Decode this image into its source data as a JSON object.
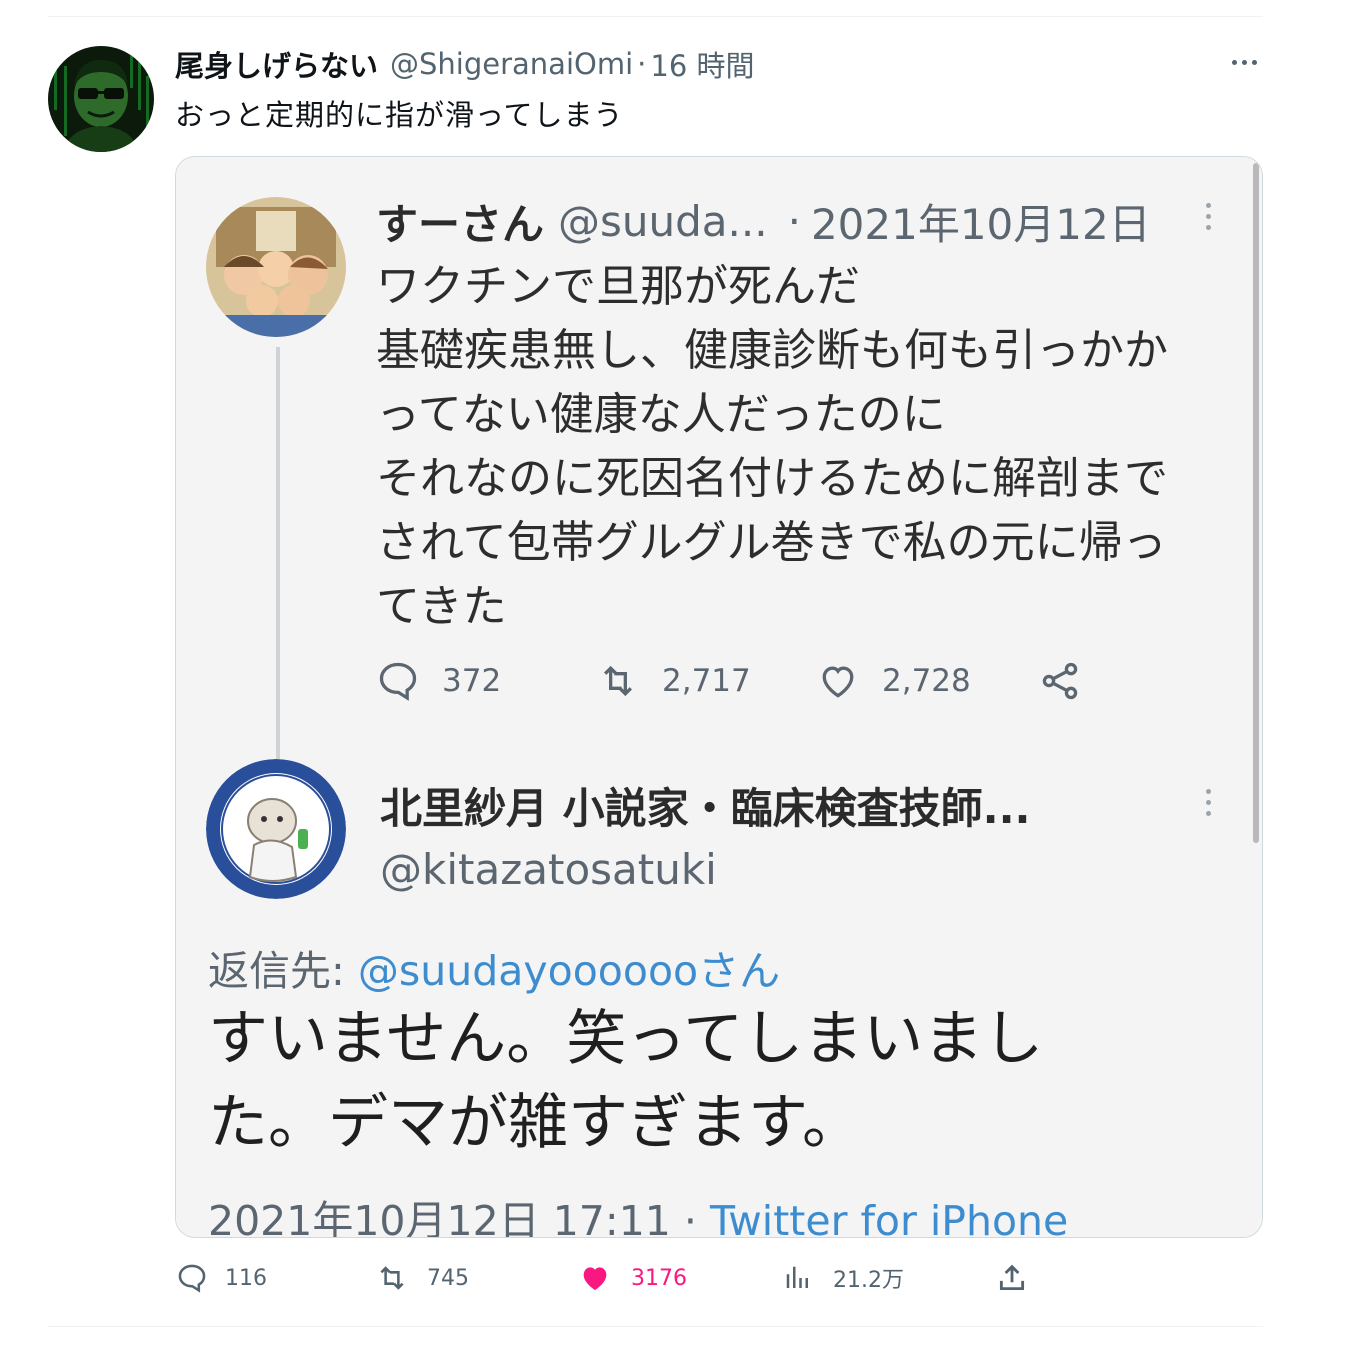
{
  "tweet": {
    "display_name": "尾身しげらない",
    "handle": "@ShigeranaiOmi",
    "separator": "·",
    "time": "16 時間",
    "text": "おっと定期的に指が滑ってしまう"
  },
  "embedded_screenshot": {
    "quoted_tweet": {
      "display_name": "すーさん",
      "handle": "@suuda...",
      "separator": "·",
      "date": "2021年10月12日",
      "lines": [
        "ワクチンで旦那が死んだ",
        "基礎疾患無し、健康診断も何も引っかか",
        "ってない健康な人だったのに",
        "それなのに死因名付けるために解剖まで",
        "されて包帯グルグル巻きで私の元に帰っ",
        "てきた"
      ],
      "replies": "372",
      "retweets": "2,717",
      "likes": "2,728"
    },
    "reply_tweet": {
      "display_name": "北里紗月 小説家・臨床検査技師...",
      "handle": "@kitazatosatuki",
      "reply_label": "返信先:",
      "reply_to": "@suudayoooooo",
      "reply_suffix": "さん",
      "lines": [
        "すいません。笑ってしまいまし",
        "た。デマが雑すぎます。"
      ],
      "timestamp": "2021年10月12日 17:11",
      "separator": "·",
      "source": "Twitter for iPhone"
    }
  },
  "footer": {
    "replies": "116",
    "retweets": "745",
    "likes": "3176",
    "views": "21.2万"
  },
  "colors": {
    "like": "#f91880",
    "secondary_text": "#536471",
    "link": "#3d8ccf"
  }
}
